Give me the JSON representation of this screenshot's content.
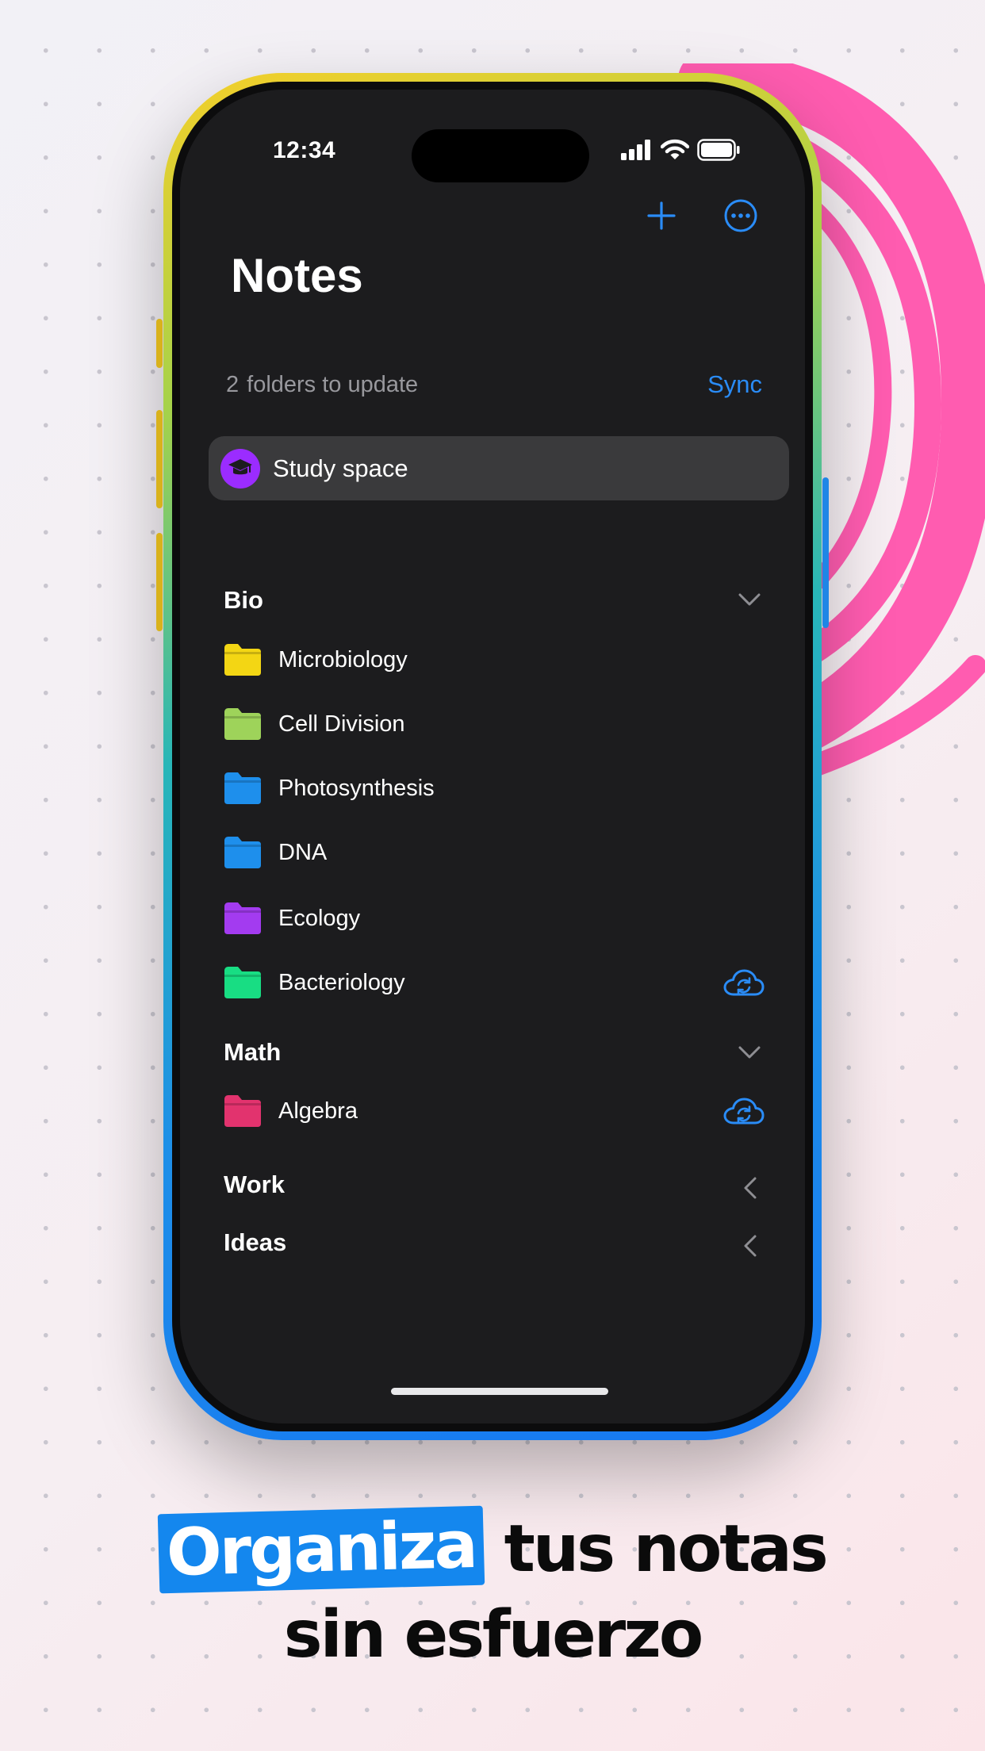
{
  "status_bar": {
    "time": "12:34"
  },
  "header": {
    "title": "Notes"
  },
  "updates": {
    "count": "2",
    "text": "folders to update",
    "sync_label": "Sync"
  },
  "space": {
    "label": "Study space",
    "icon": "graduation-cap-icon",
    "color": "#9b2cff"
  },
  "groups": [
    {
      "name": "Bio",
      "expanded": true
    },
    {
      "name": "Math",
      "expanded": true
    },
    {
      "name": "Work",
      "expanded": false
    },
    {
      "name": "Ideas",
      "expanded": false
    }
  ],
  "folders": [
    {
      "label": "Microbiology",
      "color": "#f3d614",
      "group": "Bio",
      "cloud_sync": false
    },
    {
      "label": "Cell Division",
      "color": "#9ed35a",
      "group": "Bio",
      "cloud_sync": false
    },
    {
      "label": "Photosynthesis",
      "color": "#1e8fec",
      "group": "Bio",
      "cloud_sync": false
    },
    {
      "label": "DNA",
      "color": "#1e8fec",
      "group": "Bio",
      "cloud_sync": false
    },
    {
      "label": "Ecology",
      "color": "#a33bf0",
      "group": "Bio",
      "cloud_sync": false
    },
    {
      "label": "Bacteriology",
      "color": "#18dd83",
      "group": "Bio",
      "cloud_sync": true
    },
    {
      "label": "Algebra",
      "color": "#e2336e",
      "group": "Math",
      "cloud_sync": true
    }
  ],
  "tagline": {
    "highlight": "Organiza",
    "rest_line1": "tus notas",
    "line2": "sin esfuerzo"
  },
  "colors": {
    "accent": "#2a8cf7",
    "highlight_bg": "#1487ee",
    "scribble": "#ff5cb0"
  }
}
